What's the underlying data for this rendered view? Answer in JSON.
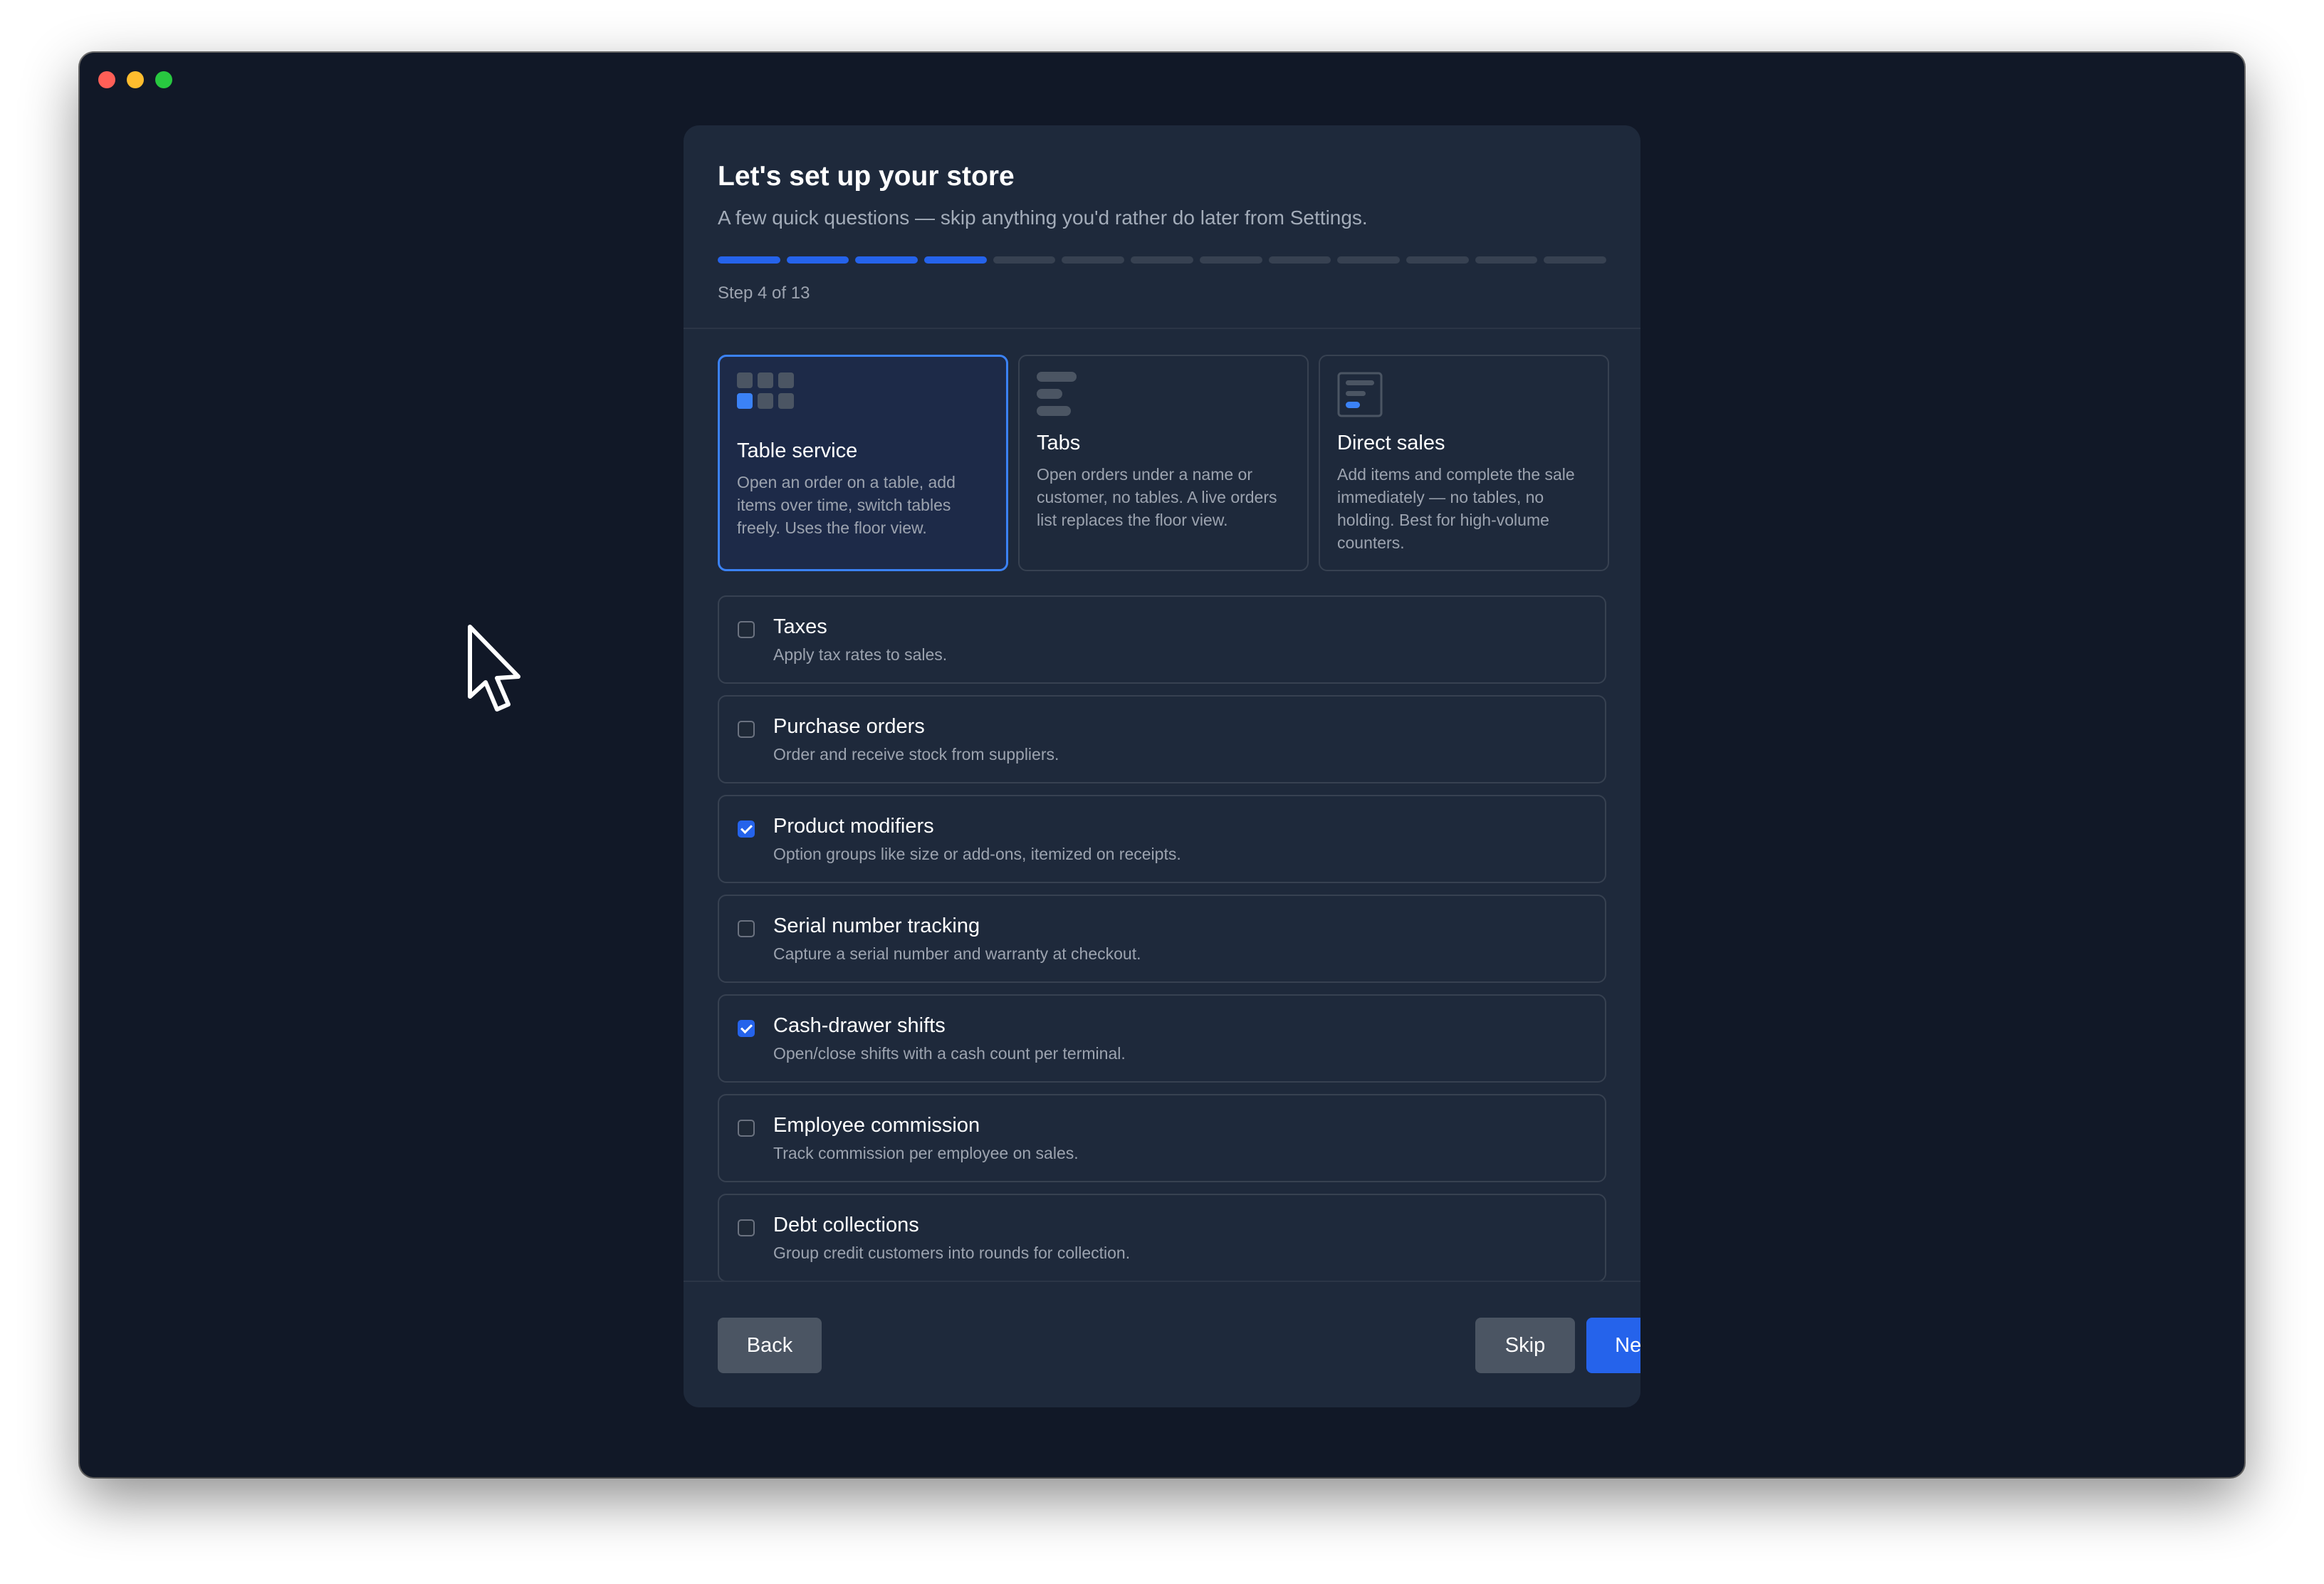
{
  "window": {
    "controls": [
      "close",
      "minimize",
      "maximize"
    ]
  },
  "header": {
    "title": "Let's set up your store",
    "subtitle": "A few quick questions — skip anything you'd rather do later from Settings.",
    "progress": {
      "current": 4,
      "total": 13
    },
    "step_label": "Step 4 of 13"
  },
  "modes": [
    {
      "title": "Table service",
      "desc": "Open an order on a table, add items over time, switch tables freely. Uses the floor view.",
      "icon": "table-grid-icon",
      "selected": true
    },
    {
      "title": "Tabs",
      "desc": "Open orders under a name or customer, no tables. A live orders list replaces the floor view.",
      "icon": "tabs-list-icon",
      "selected": false
    },
    {
      "title": "Direct sales",
      "desc": "Add items and complete the sale immediately — no tables, no holding. Best for high-volume counters.",
      "icon": "receipt-icon",
      "selected": false
    }
  ],
  "options": [
    {
      "title": "Taxes",
      "desc": "Apply tax rates to sales.",
      "checked": false
    },
    {
      "title": "Purchase orders",
      "desc": "Order and receive stock from suppliers.",
      "checked": false
    },
    {
      "title": "Product modifiers",
      "desc": "Option groups like size or add-ons, itemized on receipts.",
      "checked": true
    },
    {
      "title": "Serial number tracking",
      "desc": "Capture a serial number and warranty at checkout.",
      "checked": false
    },
    {
      "title": "Cash-drawer shifts",
      "desc": "Open/close shifts with a cash count per terminal.",
      "checked": true
    },
    {
      "title": "Employee commission",
      "desc": "Track commission per employee on sales.",
      "checked": false
    },
    {
      "title": "Debt collections",
      "desc": "Group credit customers into rounds for collection.",
      "checked": false
    }
  ],
  "footer": {
    "back_label": "Back",
    "skip_label": "Skip",
    "next_label": "Next"
  },
  "colors": {
    "accent": "#2563eb",
    "background": "#111827",
    "card": "#1e293b"
  }
}
